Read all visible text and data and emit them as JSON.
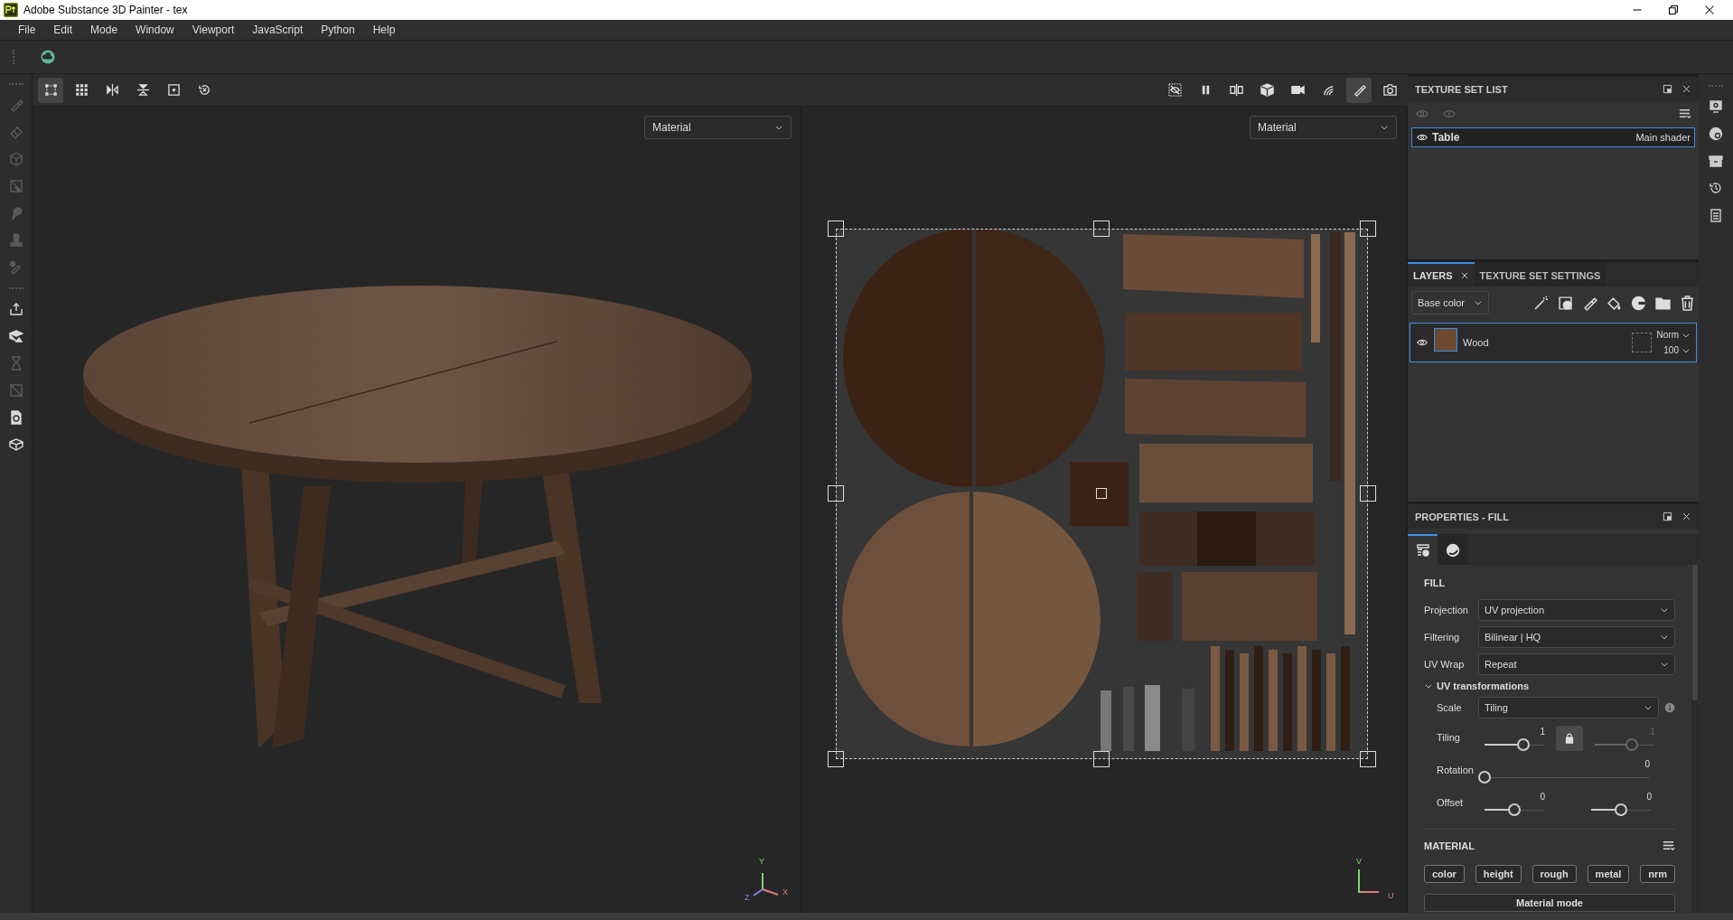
{
  "window": {
    "title": "Adobe Substance 3D Painter - tex"
  },
  "menu": [
    "File",
    "Edit",
    "Mode",
    "Window",
    "Viewport",
    "JavaScript",
    "Python",
    "Help"
  ],
  "tool_strip": [
    {
      "kind": "brush",
      "disabled": true
    },
    {
      "kind": "eraser",
      "disabled": true
    },
    {
      "kind": "projection",
      "disabled": true
    },
    {
      "kind": "polyfill",
      "disabled": true
    },
    {
      "kind": "smudge",
      "disabled": true
    },
    {
      "kind": "clone",
      "disabled": true
    },
    {
      "kind": "picker",
      "disabled": true
    },
    {
      "kind": "export",
      "disabled": false
    },
    {
      "kind": "bake",
      "disabled": false
    },
    {
      "kind": "hourglass",
      "disabled": true
    },
    {
      "kind": "crossed",
      "disabled": true
    },
    {
      "kind": "document",
      "disabled": false
    },
    {
      "kind": "box",
      "disabled": false
    }
  ],
  "viewport_toolbar": {
    "left": [
      {
        "kind": "frame",
        "selected": true
      },
      {
        "kind": "grid",
        "selected": false
      },
      {
        "kind": "mirror-x",
        "selected": false
      },
      {
        "kind": "mirror-y",
        "selected": false
      },
      {
        "kind": "focus",
        "selected": false
      },
      {
        "kind": "reset",
        "selected": false
      }
    ],
    "right": [
      {
        "kind": "hide",
        "selected": false
      },
      {
        "kind": "pause",
        "selected": false
      },
      {
        "kind": "split",
        "selected": false
      },
      {
        "kind": "cube",
        "selected": false
      },
      {
        "kind": "camera",
        "selected": false
      },
      {
        "kind": "light",
        "selected": false
      },
      {
        "kind": "brush",
        "selected": true
      },
      {
        "kind": "screenshot",
        "selected": false
      }
    ]
  },
  "viewports": [
    {
      "kind": "model",
      "mode": "Material",
      "axes": [
        "Y",
        "Z",
        "X"
      ]
    },
    {
      "kind": "uv",
      "mode": "Material",
      "axes": [
        "V",
        "U"
      ]
    }
  ],
  "texture_set_list": {
    "title": "TEXTURE SET LIST",
    "items": [
      {
        "name": "Table",
        "shader": "Main shader",
        "selected": true
      }
    ]
  },
  "layers_panel": {
    "tabs": [
      {
        "label": "LAYERS",
        "selected": true
      },
      {
        "label": "TEXTURE SET SETTINGS",
        "selected": false
      }
    ],
    "channel": "Base color",
    "layers": [
      {
        "name": "Wood",
        "blend": "Norm",
        "opacity": "100",
        "selected": true
      }
    ]
  },
  "properties": {
    "title": "PROPERTIES - FILL",
    "tabs": [
      {
        "kind": "settings",
        "selected": true
      },
      {
        "kind": "material",
        "selected": false
      }
    ],
    "section": "FILL",
    "fields": [
      {
        "label": "Projection",
        "value": "UV projection"
      },
      {
        "label": "Filtering",
        "value": "Bilinear | HQ"
      },
      {
        "label": "UV Wrap",
        "value": "Repeat"
      }
    ],
    "uv_transformations": {
      "title": "UV transformations",
      "expanded": true,
      "scale": {
        "label": "Scale",
        "value": "Tiling"
      },
      "tiling": {
        "label": "Tiling",
        "locked": true,
        "sliders": [
          {
            "reading": "1",
            "level": 0.65
          },
          {
            "reading": "1",
            "level": 0.62
          }
        ]
      },
      "rotation": {
        "label": "Rotation",
        "sliders": [
          {
            "reading": "0",
            "level": 0
          }
        ]
      },
      "offset": {
        "label": "Offset",
        "sliders": [
          {
            "reading": "0",
            "level": 0.5
          },
          {
            "reading": "0",
            "level": 0.5
          }
        ]
      }
    },
    "material": {
      "title": "MATERIAL",
      "channels": [
        {
          "label": "color",
          "on": true
        },
        {
          "label": "height",
          "on": true
        },
        {
          "label": "rough",
          "on": true
        },
        {
          "label": "metal",
          "on": true
        },
        {
          "label": "nrm",
          "on": true
        }
      ],
      "mode_button": "Material mode"
    }
  }
}
